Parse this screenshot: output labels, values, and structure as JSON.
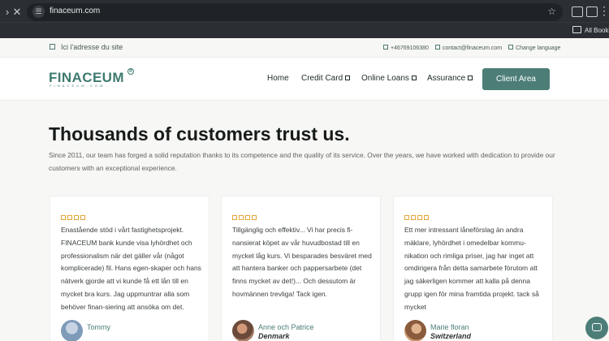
{
  "browser": {
    "url": "finaceum.com",
    "bookmarks_label": "All Bookm",
    "icons": [
      "forward-icon",
      "close-icon",
      "tune-icon",
      "star-icon",
      "extensions-icon",
      "sidebar-icon",
      "menu-icon",
      "folder-icon"
    ]
  },
  "topbar": {
    "address": "Ici l'adresse du site",
    "phone": "+46769106380",
    "email": "contact@finaceum.com",
    "language": "Change language"
  },
  "header": {
    "logo": "FINACEUM",
    "logo_reg": "R",
    "logo_sub": "FINACEUM.COM",
    "nav": {
      "home": "Home",
      "credit_card": "Credit Card",
      "online_loans": "Online Loans",
      "assurance": "Assurance"
    },
    "client_area": "Client Area"
  },
  "main": {
    "title": "Thousands of customers trust us.",
    "intro": "Since 2011, our team has forged a solid reputation thanks to its competence and the quality of its service. Over the years, we have worked with dedication to provide our customers with an exceptional experience.",
    "testimonials": [
      {
        "rating": 4,
        "text": "Enastående stöd i vårt fastighetsprojekt. FINACEUM bank kunde visa lyhördhet och professionalism när det gäller vår (något komplicerade) fil. Hans egen-skaper och hans nätverk gjorde att vi kunde få ett lån till en mycket bra kurs. Jag uppmuntrar alla som behöver finan-siering att ansöka om det.",
        "name": "Tommy",
        "country": ""
      },
      {
        "rating": 4,
        "text": "Tillgänglig och effektiv... Vi har precis fi-nansierat köpet av vår huvudbostad till en mycket låg kurs. Vi besparades besväret med att hantera banker och pappersarbete (det finns mycket av det!)... Och dessutom är hovmännen trevliga! Tack igen.",
        "name": "Anne och Patrice",
        "country": "Denmark"
      },
      {
        "rating": 4,
        "text": "Ett mer intressant låneförslag än andra mäklare, lyhördhet i omedelbar kommu-nikation och rimliga priser, jag har inget att omdirigera från detta samarbete förutom att jag säkerligen kommer att kalla på denna grupp igen för mina framtida projekt. tack så mycket",
        "name": "Marie floran",
        "country": "Switzerland"
      }
    ]
  },
  "colors": {
    "brand": "#4c7e77",
    "star": "#e2a536",
    "chrome": "#2b2f33"
  }
}
